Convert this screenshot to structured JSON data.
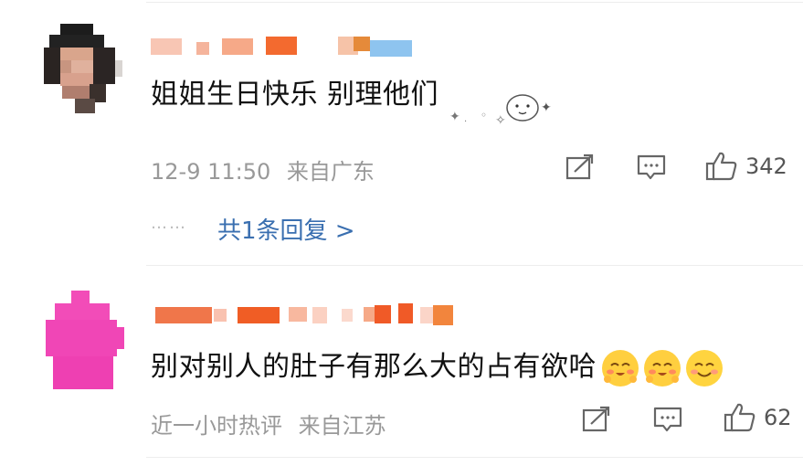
{
  "comments": [
    {
      "text": "姐姐生日快乐 别理他们",
      "time": "12-9 11:50",
      "location": "来自广东",
      "likes": "342",
      "replies_label": "共1条回复 >",
      "reply_dots": "……"
    },
    {
      "text": "别对别人的肚子有那么大的占有欲哈",
      "time": "近一小时热评",
      "location": "来自江苏",
      "likes": "62"
    }
  ],
  "icons": {
    "share": "share-icon",
    "comment": "comment-icon",
    "like": "thumbs-up-icon"
  },
  "colors": {
    "link": "#3a6fb0",
    "meta": "#999999",
    "avatar2": "#f040b0"
  }
}
